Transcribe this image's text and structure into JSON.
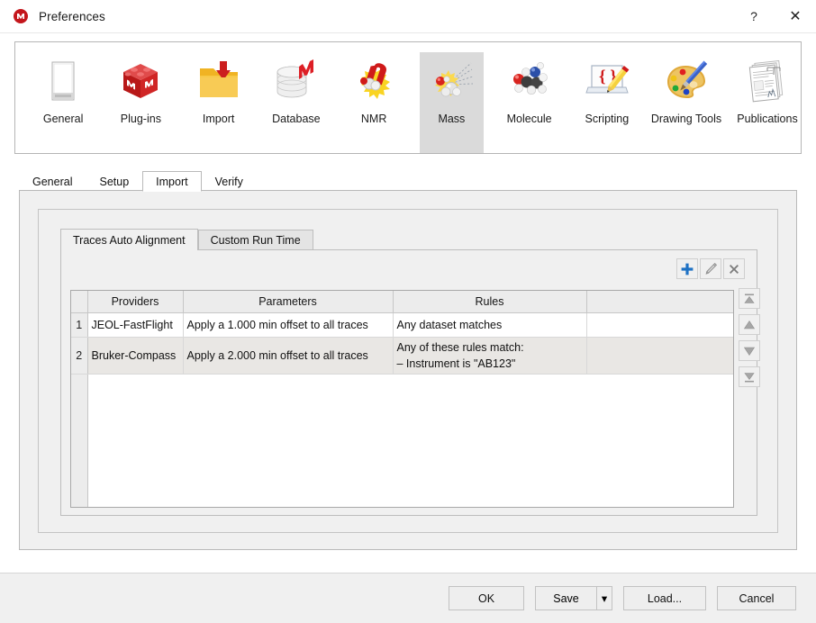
{
  "window": {
    "title": "Preferences",
    "app_icon": "mnova-logo-icon",
    "help_button": "?",
    "close_button": "✕"
  },
  "categories": [
    {
      "label": "General",
      "icon": "general-page-icon",
      "selected": false
    },
    {
      "label": "Plug-ins",
      "icon": "plugins-cube-icon",
      "selected": false
    },
    {
      "label": "Import",
      "icon": "import-folder-icon",
      "selected": false
    },
    {
      "label": "Database",
      "icon": "database-icon",
      "selected": false
    },
    {
      "label": "NMR",
      "icon": "nmr-magnet-icon",
      "selected": false
    },
    {
      "label": "Mass",
      "icon": "mass-spectro-icon",
      "selected": true
    },
    {
      "label": "Molecule",
      "icon": "molecule-icon",
      "selected": false
    },
    {
      "label": "Scripting",
      "icon": "scripting-icon",
      "selected": false
    },
    {
      "label": "Drawing Tools",
      "icon": "palette-icon",
      "selected": false
    },
    {
      "label": "Publications",
      "icon": "publications-icon",
      "selected": false
    }
  ],
  "outer_tabs": [
    {
      "label": "General",
      "active": false
    },
    {
      "label": "Setup",
      "active": false
    },
    {
      "label": "Import",
      "active": true
    },
    {
      "label": "Verify",
      "active": false
    }
  ],
  "inner_tabs": [
    {
      "label": "Traces Auto Alignment",
      "active": true
    },
    {
      "label": "Custom Run Time",
      "active": false
    }
  ],
  "mini_toolbar": [
    {
      "name": "add-button",
      "glyph": "+",
      "color": "#1f72c4"
    },
    {
      "name": "edit-button",
      "glyph": "pencil",
      "color": "#8a8a8a"
    },
    {
      "name": "delete-button",
      "glyph": "✖",
      "color": "#7c7c7c"
    }
  ],
  "order_buttons": [
    {
      "name": "move-to-top-button",
      "glyph": "move-to-top-icon"
    },
    {
      "name": "move-up-button",
      "glyph": "move-up-icon"
    },
    {
      "name": "move-down-button",
      "glyph": "move-down-icon"
    },
    {
      "name": "move-to-bottom-button",
      "glyph": "move-to-bottom-icon"
    }
  ],
  "table": {
    "columns": [
      "",
      "Providers",
      "Parameters",
      "Rules",
      ""
    ],
    "rows": [
      {
        "num": "1",
        "provider": "JEOL-FastFlight",
        "parameters": "Apply a 1.000 min offset to all traces",
        "rules_line1": "Any dataset matches",
        "rules_line2": ""
      },
      {
        "num": "2",
        "provider": "Bruker-Compass",
        "parameters": "Apply a 2.000 min offset to all traces",
        "rules_line1": "Any of these rules match:",
        "rules_line2": "– Instrument is \"AB123\""
      }
    ]
  },
  "footer": {
    "ok": "OK",
    "save": "Save",
    "save_arrow": "▾",
    "load": "Load...",
    "cancel": "Cancel"
  },
  "colors": {
    "accent_blue": "#1f72c4",
    "brand_red": "#c4161c",
    "panel_bg": "#f0f0f0",
    "row_alt": "#e9e7e4",
    "selected_icon_bg": "#dadada"
  }
}
